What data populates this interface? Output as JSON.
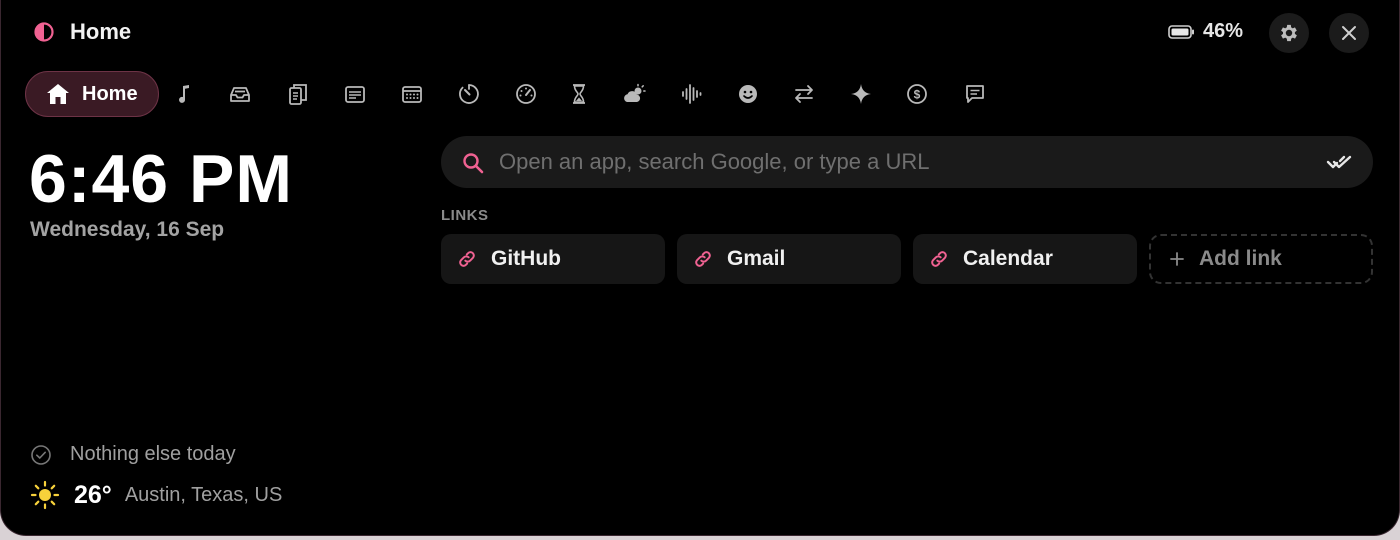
{
  "header": {
    "title": "Home",
    "battery_percent": "46%",
    "settings_icon": "gear-icon",
    "close_icon": "close-icon"
  },
  "tabs": {
    "active_label": "Home",
    "icons": [
      "music-note-icon",
      "inbox-tray-icon",
      "clipboard-icon",
      "notes-icon",
      "calendar-icon",
      "timer-icon",
      "speedometer-icon",
      "hourglass-icon",
      "weather-icon",
      "audio-waveform-icon",
      "emoji-icon",
      "convert-arrows-icon",
      "sparkle-icon",
      "currency-icon",
      "chat-icon"
    ]
  },
  "clock": {
    "time": "6:46 PM",
    "date": "Wednesday, 16 Sep"
  },
  "search": {
    "placeholder": "Open an app, search Google, or type a URL"
  },
  "links": {
    "heading": "LINKS",
    "items": [
      {
        "label": "GitHub"
      },
      {
        "label": "Gmail"
      },
      {
        "label": "Calendar"
      }
    ],
    "add_label": "Add link"
  },
  "agenda": {
    "text": "Nothing else today"
  },
  "weather": {
    "temperature": "26°",
    "location": "Austin, Texas, US"
  },
  "colors": {
    "accent": "#f06292",
    "active_tab_bg": "#3a1a24",
    "background": "#000000"
  }
}
